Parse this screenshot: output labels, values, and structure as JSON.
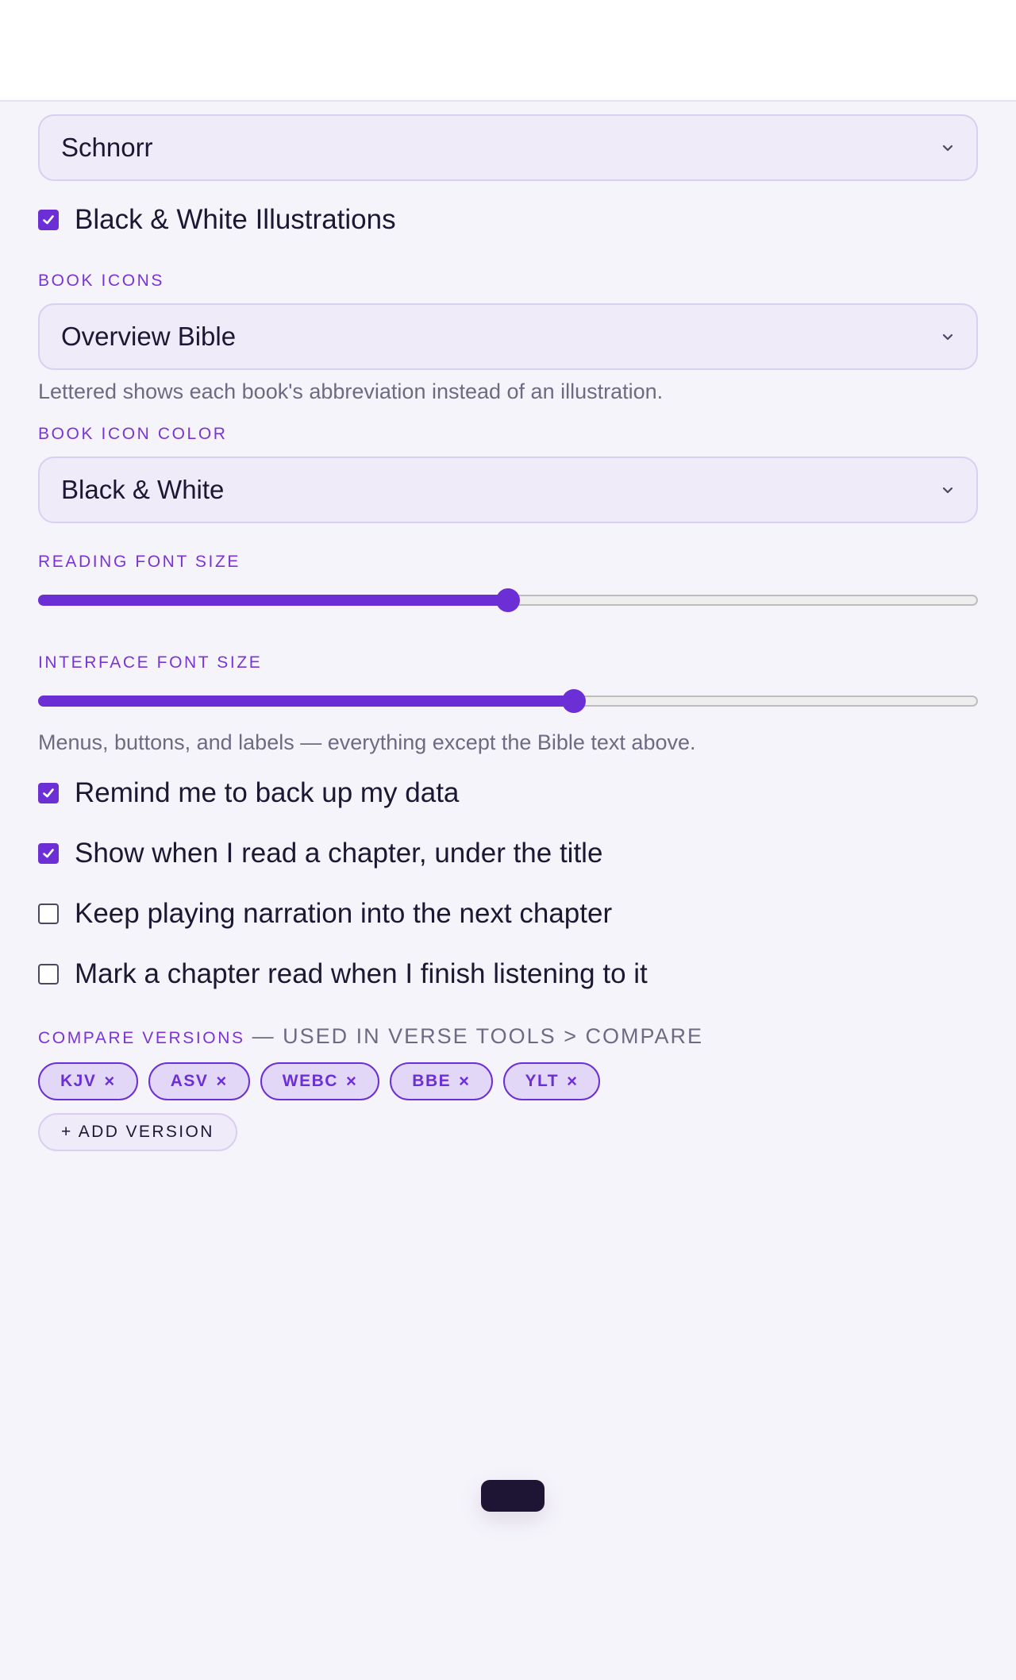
{
  "font_select": {
    "value": "Schnorr"
  },
  "bw_illustrations": {
    "label": "Black & White Illustrations",
    "checked": true
  },
  "book_icons": {
    "label": "Book Icons",
    "value": "Overview Bible",
    "hint": "Lettered shows each book's abbreviation instead of an illustration."
  },
  "book_icon_color": {
    "label": "Book Icon Color",
    "value": "Black & White"
  },
  "reading_font_size": {
    "label": "Reading Font Size",
    "level": 0.5
  },
  "interface_font_size": {
    "label": "Interface Font Size",
    "level": 0.57,
    "hint": "Menus, buttons, and labels — everything except the Bible text above."
  },
  "options": [
    {
      "label": "Remind me to back up my data",
      "checked": true
    },
    {
      "label": "Show when I read a chapter, under the title",
      "checked": true
    },
    {
      "label": "Keep playing narration into the next chapter",
      "checked": false
    },
    {
      "label": "Mark a chapter read when I finish listening to it",
      "checked": false
    }
  ],
  "compare_versions": {
    "label": "Compare Versions",
    "note": "— USED IN VERSE TOOLS > COMPARE",
    "versions": [
      "KJV",
      "ASV",
      "WEBC",
      "BBE",
      "YLT"
    ],
    "remove_glyph": "×",
    "add_label": "+ ADD VERSION"
  },
  "colors": {
    "accent": "#6c2fd6",
    "label": "#7a34d6",
    "background": "#f6f4fb",
    "pill": "#1d1533"
  },
  "icons": {
    "select_chevron": "chevron-down-icon",
    "checkbox_check": "check-icon"
  }
}
